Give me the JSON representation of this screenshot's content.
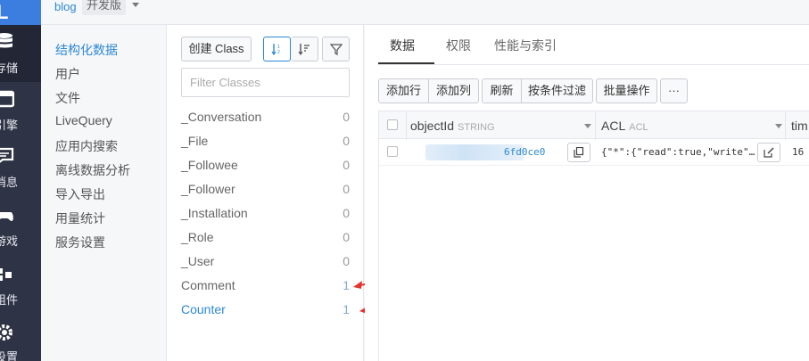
{
  "rail": {
    "logo": "L",
    "items": [
      {
        "label": "存储",
        "icon": "database-icon",
        "active": true
      },
      {
        "label": "引擎",
        "icon": "engine-icon",
        "active": false
      },
      {
        "label": "消息",
        "icon": "message-icon",
        "active": false
      },
      {
        "label": "游戏",
        "icon": "gamepad-icon",
        "active": false
      },
      {
        "label": "组件",
        "icon": "puzzle-icon",
        "active": false
      },
      {
        "label": "设置",
        "icon": "gear-icon",
        "active": false
      }
    ]
  },
  "topbar": {
    "app_name": "blog",
    "env_badge": "开发版"
  },
  "subnav": {
    "items": [
      {
        "label": "结构化数据",
        "active": true
      },
      {
        "label": "用户"
      },
      {
        "label": "文件"
      },
      {
        "label": "LiveQuery"
      },
      {
        "label": "应用内搜索"
      },
      {
        "label": "离线数据分析"
      },
      {
        "label": "导入导出"
      },
      {
        "label": "用量统计"
      },
      {
        "label": "服务设置"
      }
    ]
  },
  "classes": {
    "create_label": "创建 Class",
    "filter_placeholder": "Filter Classes",
    "list": [
      {
        "name": "_Conversation",
        "count": "0"
      },
      {
        "name": "_File",
        "count": "0"
      },
      {
        "name": "_Followee",
        "count": "0"
      },
      {
        "name": "_Follower",
        "count": "0"
      },
      {
        "name": "_Installation",
        "count": "0"
      },
      {
        "name": "_Role",
        "count": "0"
      },
      {
        "name": "_User",
        "count": "0"
      },
      {
        "name": "Comment",
        "count": "1"
      },
      {
        "name": "Counter",
        "count": "1"
      }
    ],
    "arrow_color": "#e5312c"
  },
  "main": {
    "tabs": [
      "数据",
      "权限",
      "性能与索引"
    ],
    "toolbar": {
      "add_row": "添加行",
      "add_column": "添加列",
      "refresh": "刷新",
      "filter": "按条件过滤",
      "batch": "批量操作",
      "more": "···"
    },
    "columns": [
      {
        "name": "objectId",
        "type": "STRING"
      },
      {
        "name": "ACL",
        "type": "ACL"
      },
      {
        "name": "tim",
        "type": ""
      }
    ],
    "rows": [
      {
        "object_id_visible": "6fd0ce0",
        "acl": "{\"*\":{\"read\":true,\"write\"…",
        "time": "16"
      }
    ]
  },
  "colors": {
    "accent": "#2c88d4",
    "rail": "#2e3345",
    "rail_active": "#232735"
  }
}
